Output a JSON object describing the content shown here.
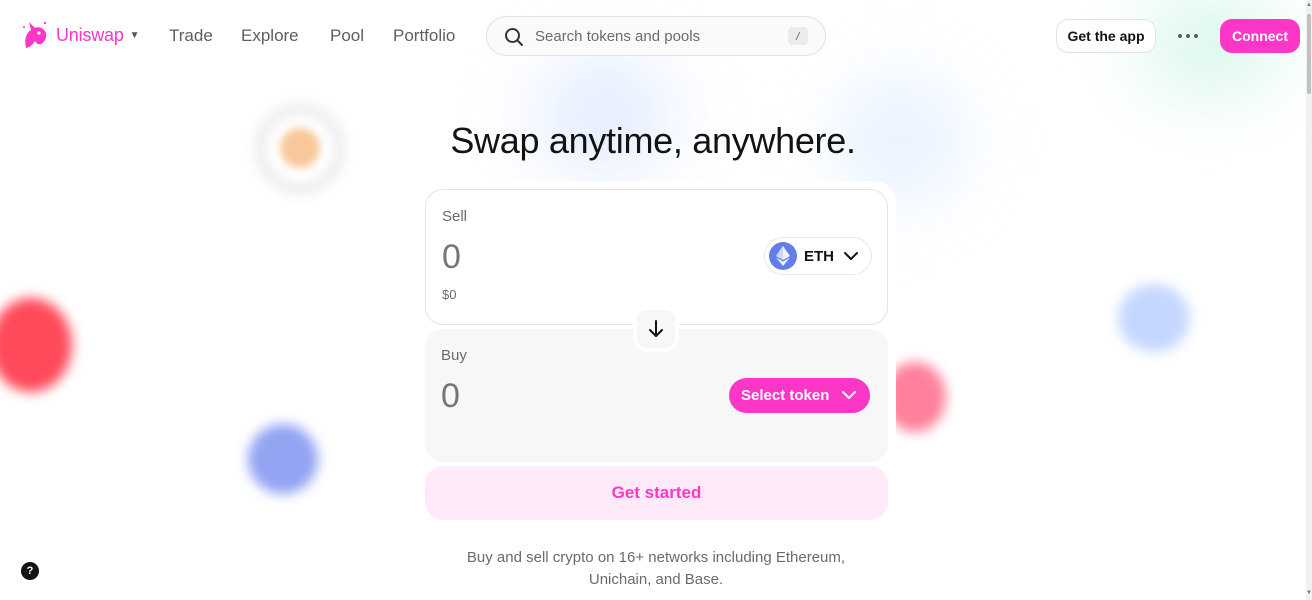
{
  "brand": {
    "name": "Uniswap",
    "accent_color": "#fc37c8"
  },
  "nav": {
    "links": [
      "Trade",
      "Explore",
      "Pool",
      "Portfolio"
    ],
    "search_placeholder": "Search tokens and pools",
    "search_shortcut": "/",
    "get_app_label": "Get the app",
    "connect_label": "Connect"
  },
  "hero": {
    "headline": "Swap anytime, anywhere."
  },
  "swap": {
    "sell": {
      "label": "Sell",
      "amount": "0",
      "usd_value": "$0",
      "token_symbol": "ETH",
      "token_icon": "ethereum-icon"
    },
    "buy": {
      "label": "Buy",
      "amount": "0",
      "select_label": "Select token"
    },
    "cta_label": "Get started"
  },
  "tagline": {
    "line1": "Buy and sell crypto on 16+ networks including Ethereum,",
    "line2": "Unichain, and Base."
  },
  "help": {
    "label": "?"
  }
}
